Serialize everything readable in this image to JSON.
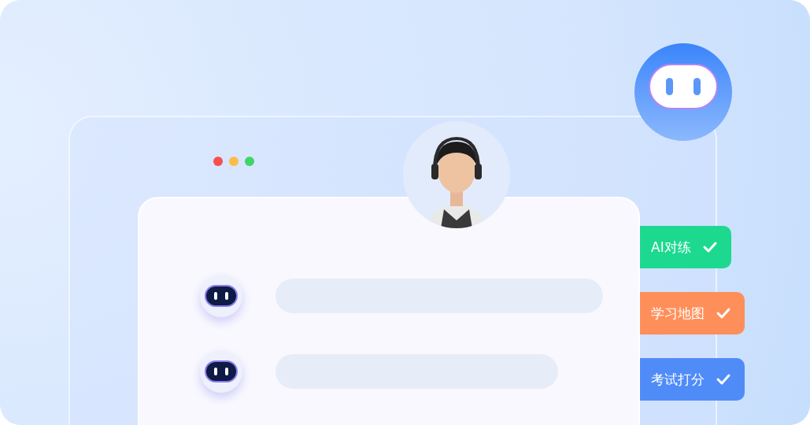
{
  "window": {
    "controls": [
      {
        "color": "#f5504f"
      },
      {
        "color": "#fdbb48"
      },
      {
        "color": "#3fd567"
      }
    ]
  },
  "chat": {
    "rows": [
      {
        "kind": "bot"
      },
      {
        "kind": "bot"
      }
    ]
  },
  "features": [
    {
      "label": "AI对练",
      "color": "#1dd990",
      "checked": true
    },
    {
      "label": "学习地图",
      "color": "#ff8f5a",
      "checked": true
    },
    {
      "label": "考试打分",
      "color": "#508cf8",
      "checked": true
    }
  ]
}
